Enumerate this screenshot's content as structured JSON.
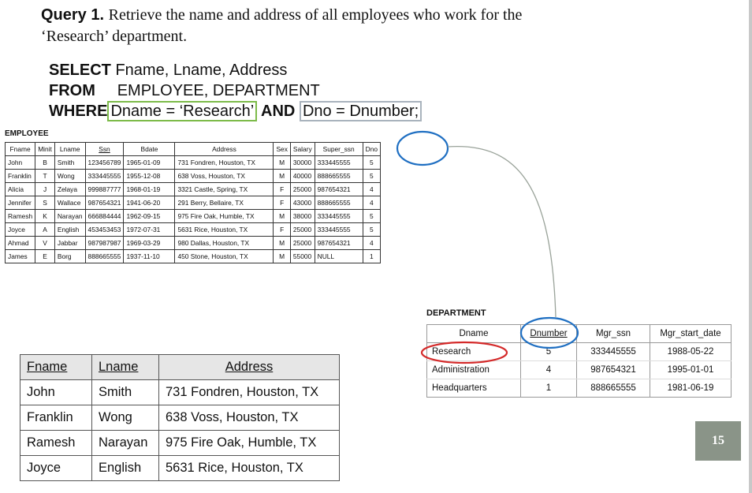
{
  "query": {
    "label": "Query 1.",
    "text_line1": "Retrieve the name and address of all employees who work for the",
    "text_line2": "‘Research’ department."
  },
  "sql": {
    "select_kw": "SELECT",
    "select_cols": "Fname, Lname, Address",
    "from_kw": "FROM",
    "from_tables": "EMPLOYEE, DEPARTMENT",
    "where_kw": "WHERE",
    "cond1": "Dname = ‘Research’",
    "and_kw": "AND",
    "cond2": "Dno = Dnumber;"
  },
  "employee": {
    "caption": "EMPLOYEE",
    "headers": [
      "Fname",
      "Minit",
      "Lname",
      "Ssn",
      "Bdate",
      "Address",
      "Sex",
      "Salary",
      "Super_ssn",
      "Dno"
    ],
    "rows": [
      [
        "John",
        "B",
        "Smith",
        "123456789",
        "1965-01-09",
        "731 Fondren, Houston, TX",
        "M",
        "30000",
        "333445555",
        "5"
      ],
      [
        "Franklin",
        "T",
        "Wong",
        "333445555",
        "1955-12-08",
        "638 Voss, Houston, TX",
        "M",
        "40000",
        "888665555",
        "5"
      ],
      [
        "Alicia",
        "J",
        "Zelaya",
        "999887777",
        "1968-01-19",
        "3321 Castle, Spring, TX",
        "F",
        "25000",
        "987654321",
        "4"
      ],
      [
        "Jennifer",
        "S",
        "Wallace",
        "987654321",
        "1941-06-20",
        "291 Berry, Bellaire, TX",
        "F",
        "43000",
        "888665555",
        "4"
      ],
      [
        "Ramesh",
        "K",
        "Narayan",
        "666884444",
        "1962-09-15",
        "975 Fire Oak, Humble, TX",
        "M",
        "38000",
        "333445555",
        "5"
      ],
      [
        "Joyce",
        "A",
        "English",
        "453453453",
        "1972-07-31",
        "5631 Rice, Houston, TX",
        "F",
        "25000",
        "333445555",
        "5"
      ],
      [
        "Ahmad",
        "V",
        "Jabbar",
        "987987987",
        "1969-03-29",
        "980 Dallas, Houston, TX",
        "M",
        "25000",
        "987654321",
        "4"
      ],
      [
        "James",
        "E",
        "Borg",
        "888665555",
        "1937-11-10",
        "450 Stone, Houston, TX",
        "M",
        "55000",
        "NULL",
        "1"
      ]
    ]
  },
  "department": {
    "caption": "DEPARTMENT",
    "headers": [
      "Dname",
      "Dnumber",
      "Mgr_ssn",
      "Mgr_start_date"
    ],
    "rows": [
      [
        "Research",
        "5",
        "333445555",
        "1988-05-22"
      ],
      [
        "Administration",
        "4",
        "987654321",
        "1995-01-01"
      ],
      [
        "Headquarters",
        "1",
        "888665555",
        "1981-06-19"
      ]
    ]
  },
  "result": {
    "headers": [
      "Fname",
      "Lname",
      "Address"
    ],
    "rows": [
      [
        "John",
        "Smith",
        "731 Fondren, Houston, TX"
      ],
      [
        "Franklin",
        "Wong",
        "638 Voss, Houston, TX"
      ],
      [
        "Ramesh",
        "Narayan",
        "975 Fire Oak, Humble, TX"
      ],
      [
        "Joyce",
        "English",
        "5631 Rice, Houston, TX"
      ]
    ]
  },
  "page_number": "15",
  "colors": {
    "condition_box": "#7dbb4a",
    "join_box": "#a9b3bd",
    "highlight_blue": "#1f6fc2",
    "highlight_red": "#d42a2a",
    "badge": "#8a9488"
  }
}
